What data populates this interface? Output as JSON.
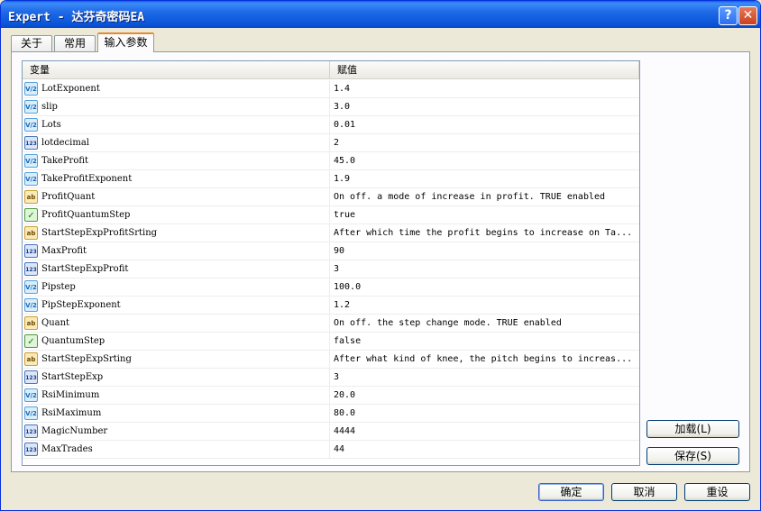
{
  "window": {
    "title": "Expert - 达芬奇密码EA",
    "help_label": "?",
    "close_label": "✕"
  },
  "tabs": [
    {
      "label": "关于"
    },
    {
      "label": "常用"
    },
    {
      "label": "输入参数"
    }
  ],
  "grid": {
    "headers": {
      "variable": "变量",
      "value": "赋值"
    },
    "rows": [
      {
        "type": "double",
        "icon_text": "V/2",
        "name": "LotExponent",
        "value": "1.4"
      },
      {
        "type": "double",
        "icon_text": "V/2",
        "name": "slip",
        "value": "3.0"
      },
      {
        "type": "double",
        "icon_text": "V/2",
        "name": "Lots",
        "value": "0.01"
      },
      {
        "type": "int",
        "icon_text": "123",
        "name": "lotdecimal",
        "value": "2"
      },
      {
        "type": "double",
        "icon_text": "V/2",
        "name": "TakeProfit",
        "value": "45.0"
      },
      {
        "type": "double",
        "icon_text": "V/2",
        "name": "TakeProfitExponent",
        "value": "1.9"
      },
      {
        "type": "string",
        "icon_text": "ab",
        "name": "ProfitQuant",
        "value": "On off. a mode of increase in profit. TRUE enabled"
      },
      {
        "type": "bool",
        "icon_text": "✓",
        "name": "ProfitQuantumStep",
        "value": "true"
      },
      {
        "type": "string",
        "icon_text": "ab",
        "name": "StartStepExpProfitSrting",
        "value": "After which time the profit begins to increase on Ta..."
      },
      {
        "type": "int",
        "icon_text": "123",
        "name": "MaxProfit",
        "value": "90"
      },
      {
        "type": "int",
        "icon_text": "123",
        "name": "StartStepExpProfit",
        "value": "3"
      },
      {
        "type": "double",
        "icon_text": "V/2",
        "name": "Pipstep",
        "value": "100.0"
      },
      {
        "type": "double",
        "icon_text": "V/2",
        "name": "PipStepExponent",
        "value": "1.2"
      },
      {
        "type": "string",
        "icon_text": "ab",
        "name": "Quant",
        "value": "On off. the step change mode. TRUE enabled"
      },
      {
        "type": "bool",
        "icon_text": "✓",
        "name": "QuantumStep",
        "value": "false"
      },
      {
        "type": "string",
        "icon_text": "ab",
        "name": "StartStepExpSrting",
        "value": "After what kind of knee, the pitch begins to increas..."
      },
      {
        "type": "int",
        "icon_text": "123",
        "name": "StartStepExp",
        "value": "3"
      },
      {
        "type": "double",
        "icon_text": "V/2",
        "name": "RsiMinimum",
        "value": "20.0"
      },
      {
        "type": "double",
        "icon_text": "V/2",
        "name": "RsiMaximum",
        "value": "80.0"
      },
      {
        "type": "int",
        "icon_text": "123",
        "name": "MagicNumber",
        "value": "4444"
      },
      {
        "type": "int",
        "icon_text": "123",
        "name": "MaxTrades",
        "value": "44"
      }
    ]
  },
  "buttons": {
    "load": "加载(L)",
    "save": "保存(S)",
    "ok": "确定",
    "cancel": "取消",
    "reset": "重设"
  },
  "colors": {
    "titlebar": "#0a53d8",
    "active_tab_accent": "#e68b2c"
  }
}
